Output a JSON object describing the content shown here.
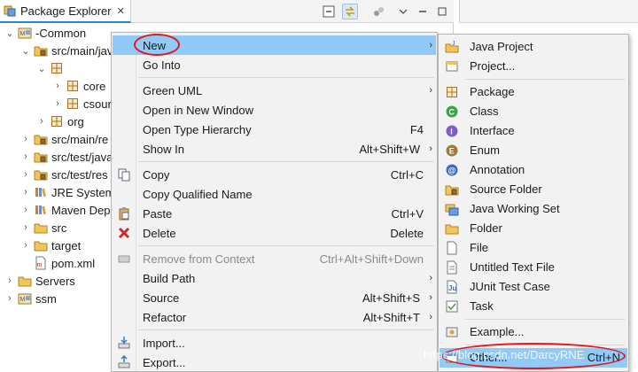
{
  "view": {
    "title": "Package Explorer",
    "close_glyph": "✕",
    "toolbar": [
      "collapse-all-icon",
      "link-with-editor-icon",
      "focus-icon",
      "view-menu-icon",
      "minimize-icon"
    ]
  },
  "tree": [
    {
      "label": "-Common",
      "indent": 0,
      "twisty": "expanded",
      "icon": "maven-project-icon"
    },
    {
      "label": "src/main/jav",
      "indent": 1,
      "twisty": "expanded",
      "icon": "source-folder-icon"
    },
    {
      "label": "",
      "indent": 2,
      "twisty": "expanded",
      "icon": "package-icon"
    },
    {
      "label": "core",
      "indent": 3,
      "twisty": "collapsed",
      "icon": "package-icon"
    },
    {
      "label": "csour",
      "indent": 3,
      "twisty": "collapsed",
      "icon": "package-icon"
    },
    {
      "label": "org",
      "indent": 2,
      "twisty": "collapsed",
      "icon": "package-icon"
    },
    {
      "label": "src/main/re",
      "indent": 1,
      "twisty": "collapsed",
      "icon": "source-folder-icon"
    },
    {
      "label": "src/test/java",
      "indent": 1,
      "twisty": "collapsed",
      "icon": "source-folder-icon"
    },
    {
      "label": "src/test/res",
      "indent": 1,
      "twisty": "collapsed",
      "icon": "source-folder-icon"
    },
    {
      "label": "JRE System",
      "indent": 1,
      "twisty": "collapsed",
      "icon": "library-icon"
    },
    {
      "label": "Maven Dep",
      "indent": 1,
      "twisty": "collapsed",
      "icon": "library-icon"
    },
    {
      "label": "src",
      "indent": 1,
      "twisty": "collapsed",
      "icon": "folder-icon"
    },
    {
      "label": "target",
      "indent": 1,
      "twisty": "collapsed",
      "icon": "folder-icon"
    },
    {
      "label": "pom.xml",
      "indent": 1,
      "twisty": "none",
      "icon": "xml-file-icon"
    },
    {
      "label": "Servers",
      "indent": 0,
      "twisty": "collapsed",
      "icon": "folder-icon"
    },
    {
      "label": "ssm",
      "indent": 0,
      "twisty": "collapsed",
      "icon": "maven-project-icon"
    }
  ],
  "menu": {
    "items": [
      {
        "label": "New",
        "accel": "",
        "submenu": true,
        "icon": "",
        "highlight": true
      },
      {
        "label": "Go Into",
        "accel": "",
        "submenu": false,
        "icon": ""
      },
      {
        "sep": true
      },
      {
        "label": "Green UML",
        "accel": "",
        "submenu": true,
        "icon": ""
      },
      {
        "label": "Open in New Window",
        "accel": "",
        "submenu": false,
        "icon": ""
      },
      {
        "label": "Open Type Hierarchy",
        "accel": "F4",
        "submenu": false,
        "icon": ""
      },
      {
        "label": "Show In",
        "accel": "Alt+Shift+W",
        "submenu": true,
        "icon": ""
      },
      {
        "sep": true
      },
      {
        "label": "Copy",
        "accel": "Ctrl+C",
        "submenu": false,
        "icon": "copy-icon"
      },
      {
        "label": "Copy Qualified Name",
        "accel": "",
        "submenu": false,
        "icon": ""
      },
      {
        "label": "Paste",
        "accel": "Ctrl+V",
        "submenu": false,
        "icon": "paste-icon"
      },
      {
        "label": "Delete",
        "accel": "Delete",
        "submenu": false,
        "icon": "delete-icon"
      },
      {
        "sep": true
      },
      {
        "label": "Remove from Context",
        "accel": "Ctrl+Alt+Shift+Down",
        "submenu": false,
        "icon": "remove-context-icon",
        "disabled": true
      },
      {
        "label": "Build Path",
        "accel": "",
        "submenu": true,
        "icon": ""
      },
      {
        "label": "Source",
        "accel": "Alt+Shift+S",
        "submenu": true,
        "icon": ""
      },
      {
        "label": "Refactor",
        "accel": "Alt+Shift+T",
        "submenu": true,
        "icon": ""
      },
      {
        "sep": true
      },
      {
        "label": "Import...",
        "accel": "",
        "submenu": false,
        "icon": "import-icon"
      },
      {
        "label": "Export...",
        "accel": "",
        "submenu": false,
        "icon": "export-icon"
      }
    ]
  },
  "submenu": {
    "items": [
      {
        "label": "Java Project",
        "icon": "java-project-icon"
      },
      {
        "label": "Project...",
        "icon": "project-icon"
      },
      {
        "sep": true
      },
      {
        "label": "Package",
        "icon": "package-icon"
      },
      {
        "label": "Class",
        "icon": "class-icon"
      },
      {
        "label": "Interface",
        "icon": "interface-icon"
      },
      {
        "label": "Enum",
        "icon": "enum-icon"
      },
      {
        "label": "Annotation",
        "icon": "annotation-icon"
      },
      {
        "label": "Source Folder",
        "icon": "source-folder-icon"
      },
      {
        "label": "Java Working Set",
        "icon": "working-set-icon"
      },
      {
        "label": "Folder",
        "icon": "folder-icon"
      },
      {
        "label": "File",
        "icon": "file-icon"
      },
      {
        "label": "Untitled Text File",
        "icon": "text-file-icon"
      },
      {
        "label": "JUnit Test Case",
        "icon": "junit-icon"
      },
      {
        "label": "Task",
        "icon": "task-icon"
      },
      {
        "sep": true
      },
      {
        "label": "Example...",
        "icon": "example-icon"
      },
      {
        "sep": true
      },
      {
        "label": "Other...",
        "accel": "Ctrl+N",
        "icon": "other-icon",
        "highlight": true
      }
    ]
  },
  "watermark": "https://blog.csdn.net/DarcyRNE",
  "colors": {
    "highlight": "#91c9f7",
    "annotation": "#e0191f",
    "accent": "#2f7fd6"
  }
}
